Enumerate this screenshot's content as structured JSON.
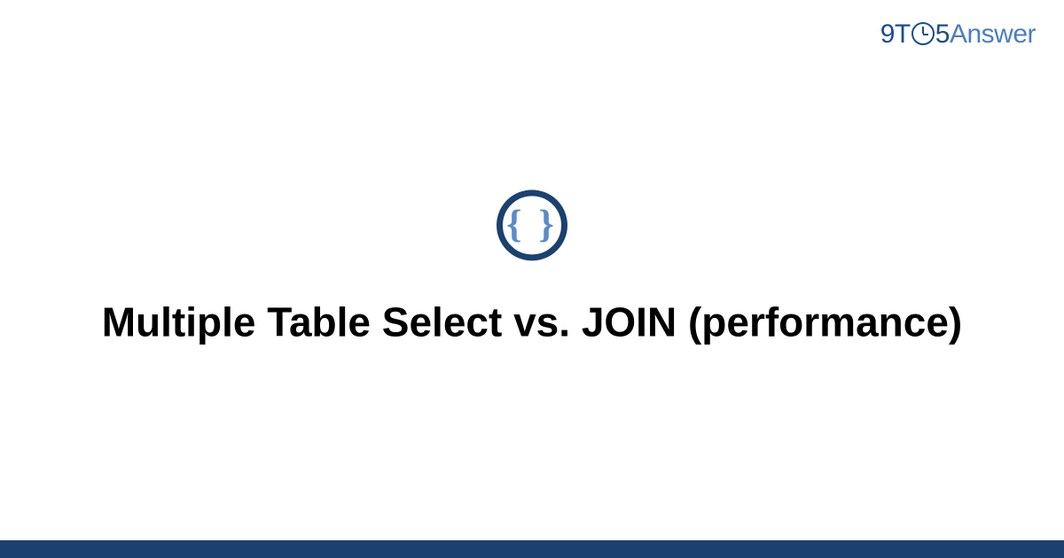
{
  "logo": {
    "part1": "9T",
    "part2": "5",
    "part3": "Answer"
  },
  "icon": {
    "braces": "{ }"
  },
  "title": "Multiple Table Select vs. JOIN (performance)",
  "colors": {
    "darkBlue": "#1b4171",
    "mediumBlue": "#1b4d8f",
    "lightBlue": "#5b8bc9",
    "logoLight": "#4a7ec4"
  }
}
